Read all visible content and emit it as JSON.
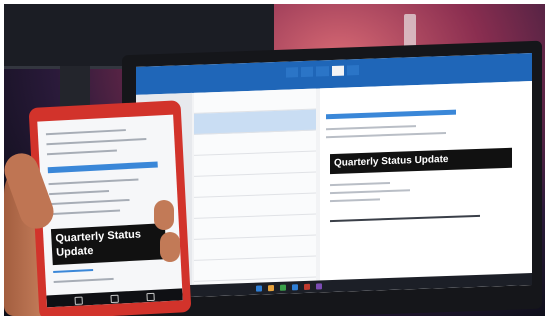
{
  "scene": {
    "laptop": {
      "ribbon_tabs": [
        "",
        "",
        "",
        "",
        ""
      ],
      "reading_pane_banner": "Quarterly Status Update"
    },
    "phone": {
      "email_banner_line1": "Quarterly Status",
      "email_banner_line2": "Update"
    }
  },
  "colors": {
    "outlook_blue": "#1f66b8",
    "phone_red": "#d2332b",
    "banner_black": "#111111"
  }
}
